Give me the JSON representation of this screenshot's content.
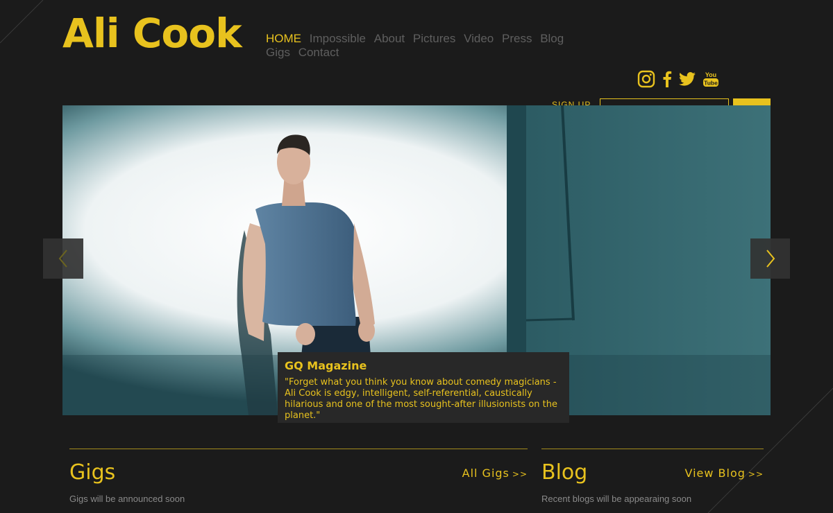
{
  "site": {
    "name": "Ali Cook"
  },
  "nav": {
    "items": [
      {
        "label": "HOME"
      },
      {
        "label": "Impossible"
      },
      {
        "label": "About"
      },
      {
        "label": "Pictures"
      },
      {
        "label": "Video"
      },
      {
        "label": "Press"
      },
      {
        "label": "Blog"
      },
      {
        "label": "Gigs"
      },
      {
        "label": "Contact"
      }
    ]
  },
  "social": [
    "instagram-icon",
    "facebook-icon",
    "twitter-icon",
    "youtube-icon"
  ],
  "signup": {
    "label": "SIGN UP"
  },
  "slider": {
    "caption_title": "GQ Magazine",
    "caption_text": "\"Forget what you think you know about comedy magicians - Ali Cook is edgy, intelligent, self-referential, caustically hilarious and one of the most sought-after illusionists on the planet.\""
  },
  "gigs": {
    "title": "Gigs",
    "link": "All Gigs",
    "link_chevron": ">>",
    "note": "Gigs will be announced soon"
  },
  "blog": {
    "title": "Blog",
    "link": "View Blog",
    "link_chevron": ">>",
    "note": "Recent blogs will be appearaing soon"
  },
  "colors": {
    "accent": "#e8c21e",
    "background": "#1b1b1b",
    "nav_inactive": "#5f5f5f"
  }
}
